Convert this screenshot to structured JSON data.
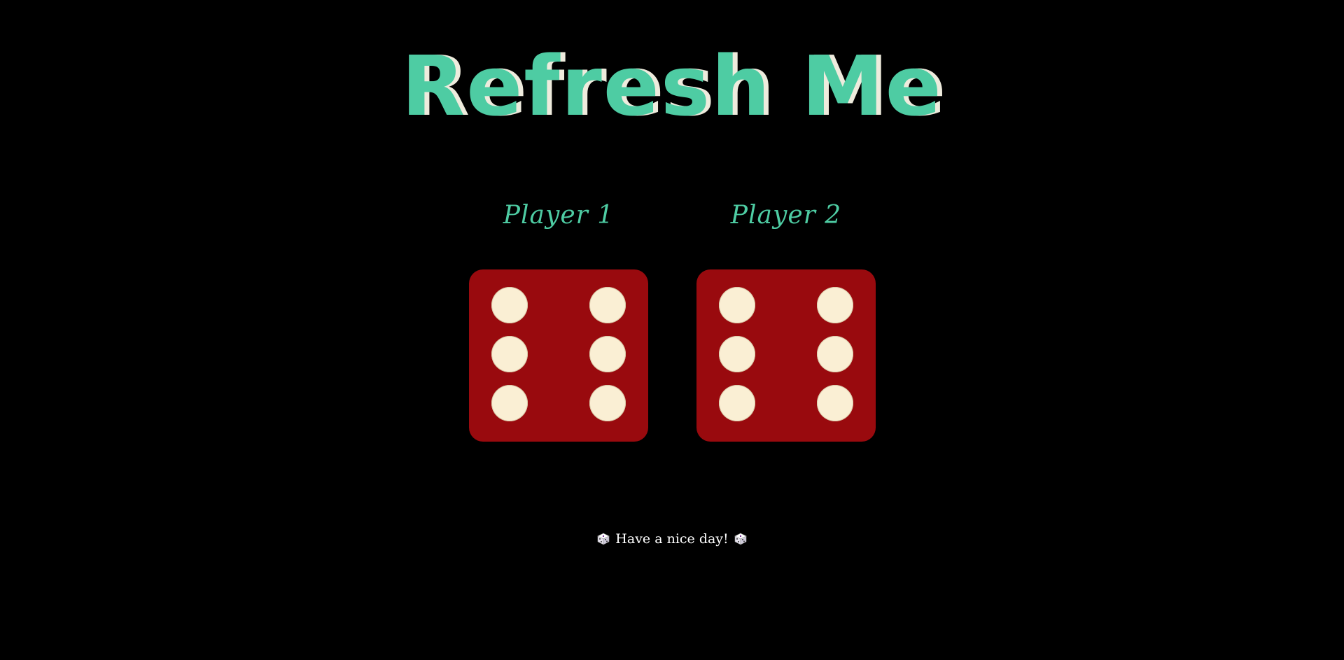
{
  "title": "Refresh Me",
  "players": [
    {
      "label": "Player 1",
      "die_value": 6
    },
    {
      "label": "Player 2",
      "die_value": 6
    }
  ],
  "footer": {
    "text": "Have a nice day!",
    "icon_left": "game-die-icon",
    "icon_right": "game-die-icon"
  },
  "colors": {
    "background": "#000000",
    "title": "#4ECCA3",
    "title_shadow": "#EEEBDD",
    "die": "#990A0E",
    "pip": "#FAEFD4",
    "footer_text": "#FFFFFF"
  }
}
